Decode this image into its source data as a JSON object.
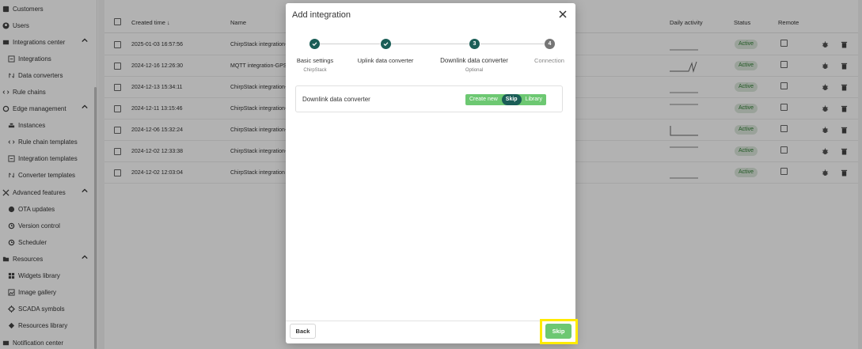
{
  "sidebar": {
    "items": [
      {
        "label": "Customers",
        "icon": "customers-icon",
        "level": "top"
      },
      {
        "label": "Users",
        "icon": "users-icon",
        "level": "top"
      },
      {
        "label": "Integrations center",
        "icon": "integrations-icon",
        "level": "top",
        "expanded": true
      },
      {
        "label": "Integrations",
        "icon": "integration-icon",
        "level": "sub"
      },
      {
        "label": "Data converters",
        "icon": "converter-icon",
        "level": "sub"
      },
      {
        "label": "Rule chains",
        "icon": "rule-chains-icon",
        "level": "top"
      },
      {
        "label": "Edge management",
        "icon": "edge-icon",
        "level": "top",
        "expanded": true
      },
      {
        "label": "Instances",
        "icon": "instances-icon",
        "level": "sub"
      },
      {
        "label": "Rule chain templates",
        "icon": "rule-template-icon",
        "level": "sub"
      },
      {
        "label": "Integration templates",
        "icon": "integration-template-icon",
        "level": "sub"
      },
      {
        "label": "Converter templates",
        "icon": "converter-template-icon",
        "level": "sub"
      },
      {
        "label": "Advanced features",
        "icon": "advanced-icon",
        "level": "top",
        "expanded": true
      },
      {
        "label": "OTA updates",
        "icon": "ota-icon",
        "level": "sub"
      },
      {
        "label": "Version control",
        "icon": "version-icon",
        "level": "sub"
      },
      {
        "label": "Scheduler",
        "icon": "scheduler-icon",
        "level": "sub"
      },
      {
        "label": "Resources",
        "icon": "folder-icon",
        "level": "top",
        "expanded": true
      },
      {
        "label": "Widgets library",
        "icon": "widgets-icon",
        "level": "sub"
      },
      {
        "label": "Image gallery",
        "icon": "image-icon",
        "level": "sub"
      },
      {
        "label": "SCADA symbols",
        "icon": "scada-icon",
        "level": "sub"
      },
      {
        "label": "Resources library",
        "icon": "resources-icon",
        "level": "sub"
      },
      {
        "label": "Notification center",
        "icon": "notification-icon",
        "level": "top"
      }
    ]
  },
  "table": {
    "headers": {
      "created_time": "Created time ↓",
      "name": "Name",
      "daily_activity": "Daily activity",
      "status": "Status",
      "remote": "Remote"
    },
    "rows": [
      {
        "created": "2025-01-03 16:57:56",
        "name": "ChirpStack integration-",
        "status": "Active"
      },
      {
        "created": "2024-12-16 12:26:30",
        "name": "MQTT integration-GPS",
        "status": "Active"
      },
      {
        "created": "2024-12-13 15:34:11",
        "name": "ChirpStack integration-",
        "status": "Active"
      },
      {
        "created": "2024-12-11 13:15:46",
        "name": "ChirpStack integration-",
        "status": "Active"
      },
      {
        "created": "2024-12-06 15:32:24",
        "name": "ChirpStack integration-",
        "status": "Active"
      },
      {
        "created": "2024-12-02 12:33:38",
        "name": "ChirpStack integration-",
        "status": "Active"
      },
      {
        "created": "2024-12-02 12:03:04",
        "name": "ChirpStack integration",
        "status": "Active"
      }
    ]
  },
  "dialog": {
    "title": "Add integration",
    "steps": [
      {
        "number": "1",
        "label": "Basic settings",
        "sub": "ChirpStack",
        "state": "done"
      },
      {
        "number": "2",
        "label": "Uplink data converter",
        "sub": "",
        "state": "done"
      },
      {
        "number": "3",
        "label": "Downlink data converter",
        "sub": "Optional",
        "state": "active"
      },
      {
        "number": "4",
        "label": "Connection",
        "sub": "",
        "state": "pending"
      }
    ],
    "converter": {
      "label": "Downlink data converter",
      "options": [
        "Create new",
        "Skip",
        "Library"
      ],
      "selected": "Skip"
    },
    "back_label": "Back",
    "skip_label": "Skip"
  },
  "colors": {
    "primary": "#1b5e57",
    "accent_green": "#6dc872",
    "badge_bg": "#dde9dd",
    "highlight": "#ffeb00"
  }
}
